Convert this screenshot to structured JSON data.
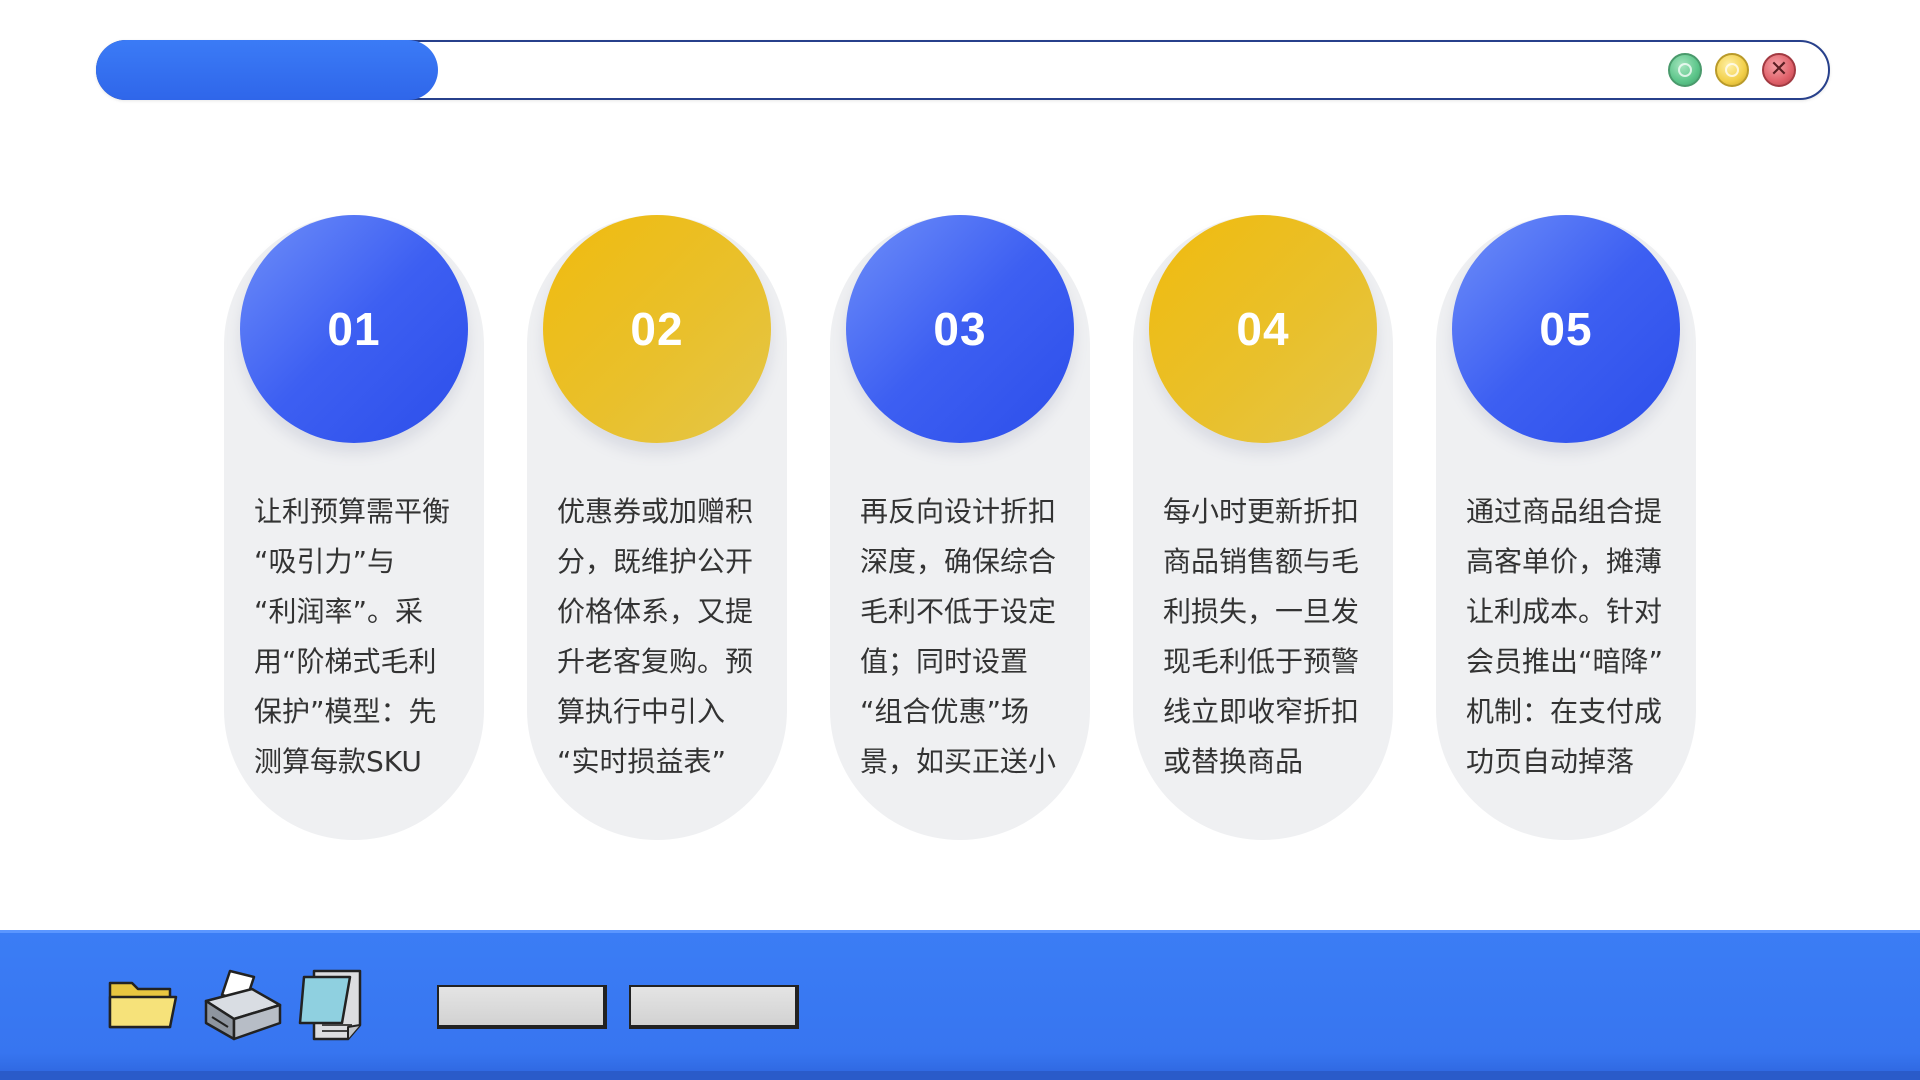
{
  "window": {
    "buttons": [
      {
        "name": "minimize",
        "color": "#5cc58a"
      },
      {
        "name": "maximize",
        "color": "#f2cf49"
      },
      {
        "name": "close",
        "color": "#e0616a"
      }
    ]
  },
  "steps": [
    {
      "number": "01",
      "color": "#3d5ff2",
      "text": "让利预算需平衡\n“吸引力”与\n“利润率”。采\n用“阶梯式毛利\n保护”模型：先\n测算每款SKU"
    },
    {
      "number": "02",
      "color": "#f0bb0e",
      "text": "优惠券或加赠积\n分，既维护公开\n价格体系，又提\n升老客复购。预\n算执行中引入\n“实时损益表”"
    },
    {
      "number": "03",
      "color": "#3d5ff2",
      "text": "再反向设计折扣\n深度，确保综合\n毛利不低于设定\n值；同时设置\n“组合优惠”场\n景，如买正送小"
    },
    {
      "number": "04",
      "color": "#f0bb0e",
      "text": "每小时更新折扣\n商品销售额与毛\n利损失，一旦发\n现毛利低于预警\n线立即收窄折扣\n或替换商品"
    },
    {
      "number": "05",
      "color": "#3d5ff2",
      "text": "通过商品组合提\n高客单价，摊薄\n让利成本。针对\n会员推出“暗降”\n机制：在支付成\n功页自动掉落"
    }
  ],
  "taskbar": {
    "icons": [
      "folder-icon",
      "printer-icon",
      "notepad-icon"
    ],
    "buttons": [
      "",
      ""
    ]
  },
  "colors": {
    "accent_blue": "#3775f0",
    "accent_gold": "#f0bb0e",
    "card_bg": "#eff0f2"
  }
}
